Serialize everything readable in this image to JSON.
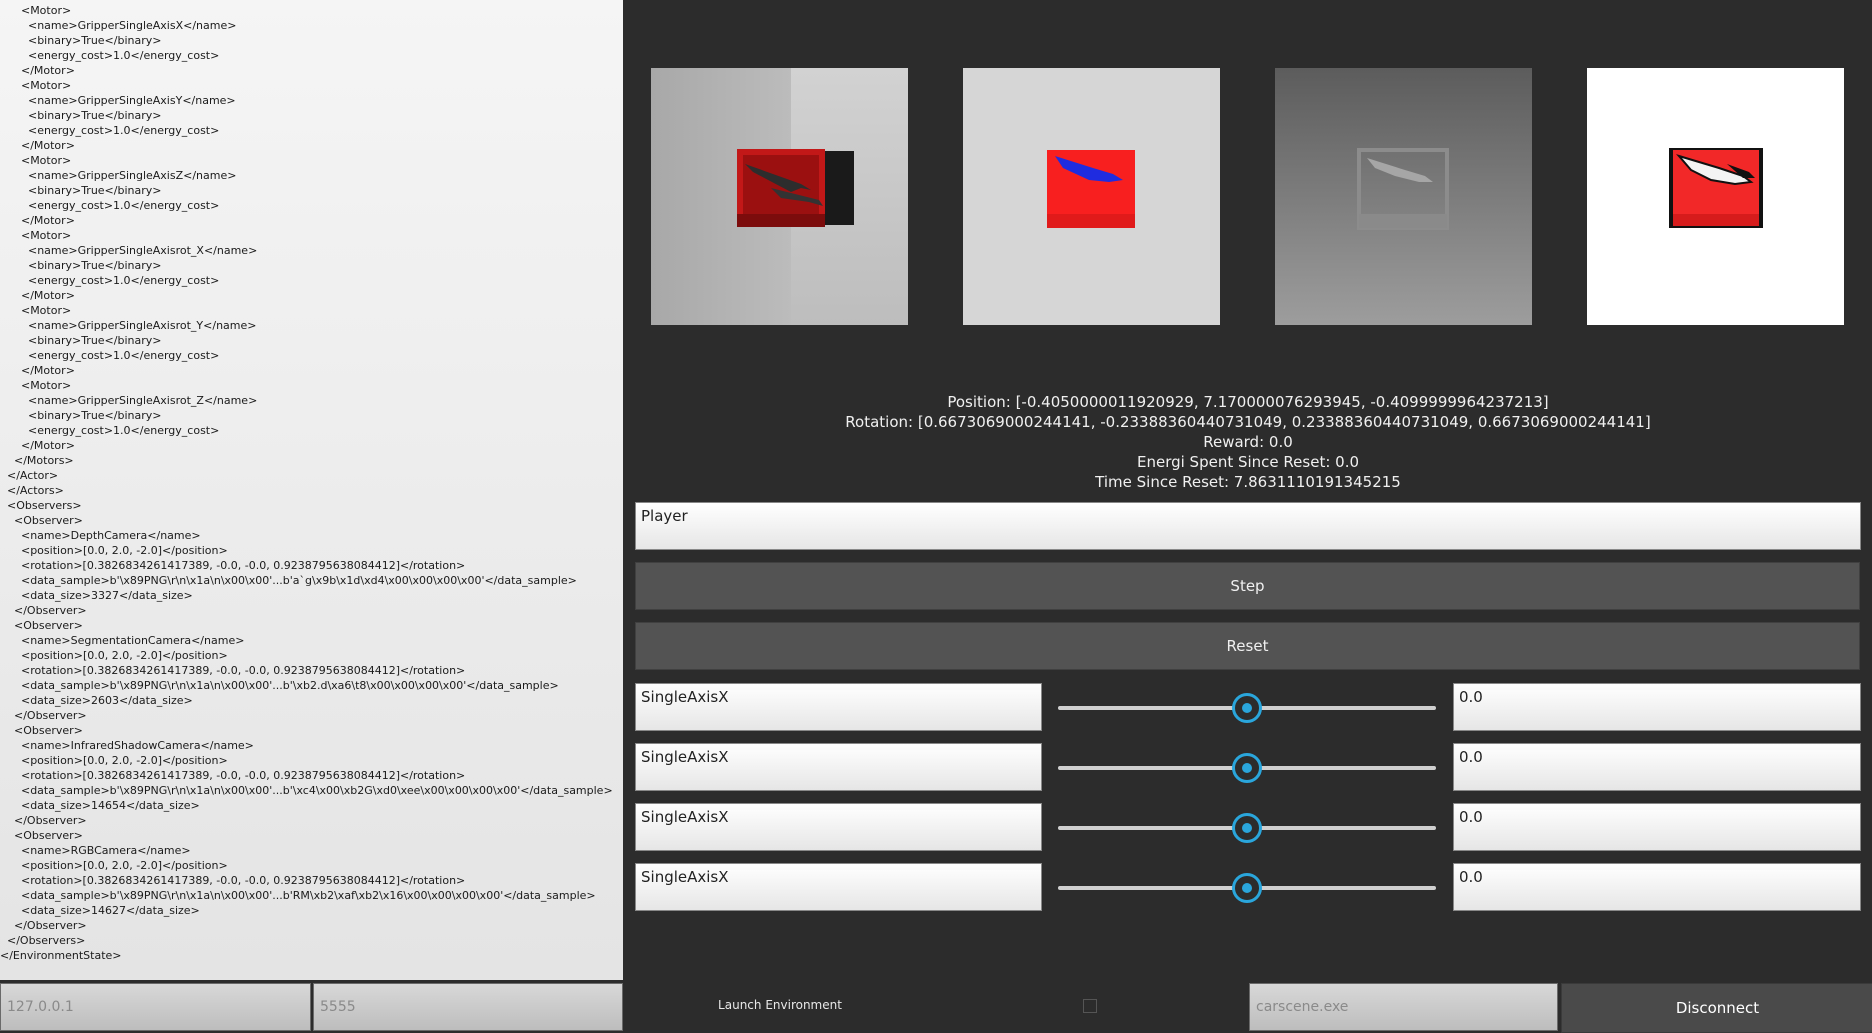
{
  "xml_lines": [
    "      <Motor>",
    "        <name>GripperSingleAxisX</name>",
    "        <binary>True</binary>",
    "        <energy_cost>1.0</energy_cost>",
    "      </Motor>",
    "      <Motor>",
    "        <name>GripperSingleAxisY</name>",
    "        <binary>True</binary>",
    "        <energy_cost>1.0</energy_cost>",
    "      </Motor>",
    "      <Motor>",
    "        <name>GripperSingleAxisZ</name>",
    "        <binary>True</binary>",
    "        <energy_cost>1.0</energy_cost>",
    "      </Motor>",
    "      <Motor>",
    "        <name>GripperSingleAxisrot_X</name>",
    "        <binary>True</binary>",
    "        <energy_cost>1.0</energy_cost>",
    "      </Motor>",
    "      <Motor>",
    "        <name>GripperSingleAxisrot_Y</name>",
    "        <binary>True</binary>",
    "        <energy_cost>1.0</energy_cost>",
    "      </Motor>",
    "      <Motor>",
    "        <name>GripperSingleAxisrot_Z</name>",
    "        <binary>True</binary>",
    "        <energy_cost>1.0</energy_cost>",
    "      </Motor>",
    "    </Motors>",
    "  </Actor>",
    "  </Actors>",
    "  <Observers>",
    "    <Observer>",
    "      <name>DepthCamera</name>",
    "      <position>[0.0, 2.0, -2.0]</position>",
    "      <rotation>[0.3826834261417389, -0.0, -0.0, 0.9238795638084412]</rotation>",
    "      <data_sample>b'\\x89PNG\\r\\n\\x1a\\n\\x00\\x00'...b'a`g\\x9b\\x1d\\xd4\\x00\\x00\\x00\\x00'</data_sample>",
    "      <data_size>3327</data_size>",
    "    </Observer>",
    "    <Observer>",
    "      <name>SegmentationCamera</name>",
    "      <position>[0.0, 2.0, -2.0]</position>",
    "      <rotation>[0.3826834261417389, -0.0, -0.0, 0.9238795638084412]</rotation>",
    "      <data_sample>b'\\x89PNG\\r\\n\\x1a\\n\\x00\\x00'...b'\\xb2.d\\xa6\\t8\\x00\\x00\\x00\\x00'</data_sample>",
    "      <data_size>2603</data_size>",
    "    </Observer>",
    "    <Observer>",
    "      <name>InfraredShadowCamera</name>",
    "      <position>[0.0, 2.0, -2.0]</position>",
    "      <rotation>[0.3826834261417389, -0.0, -0.0, 0.9238795638084412]</rotation>",
    "      <data_sample>b'\\x89PNG\\r\\n\\x1a\\n\\x00\\x00'...b'\\xc4\\x00\\xb2G\\xd0\\xee\\x00\\x00\\x00\\x00'</data_sample>",
    "      <data_size>14654</data_size>",
    "    </Observer>",
    "    <Observer>",
    "      <name>RGBCamera</name>",
    "      <position>[0.0, 2.0, -2.0]</position>",
    "      <rotation>[0.3826834261417389, -0.0, -0.0, 0.9238795638084412]</rotation>",
    "      <data_sample>b'\\x89PNG\\r\\n\\x1a\\n\\x00\\x00'...b'RM\\xb2\\xaf\\xb2\\x16\\x00\\x00\\x00\\x00'</data_sample>",
    "      <data_size>14627</data_size>",
    "    </Observer>",
    "  </Observers>",
    "</EnvironmentState>"
  ],
  "connection": {
    "ip": "127.0.0.1",
    "port": "5555",
    "launch_label": "Launch Environment",
    "launch_checked": false,
    "executable": "carscene.exe",
    "disconnect_label": "Disconnect"
  },
  "cameras": [
    {
      "name": "depth-camera-view"
    },
    {
      "name": "segmentation-camera-view"
    },
    {
      "name": "infrared-shadow-camera-view"
    },
    {
      "name": "rgb-camera-view"
    }
  ],
  "status": {
    "position": "Position: [-0.4050000011920929, 7.170000076293945, -0.4099999964237213]",
    "rotation": "Rotation: [0.6673069000244141, -0.23388360440731049, 0.23388360440731049, 0.6673069000244141]",
    "reward": "Reward: 0.0",
    "energy": "Energi Spent Since Reset: 0.0",
    "time": "Time Since Reset: 7.8631110191345215"
  },
  "player_field": "Player",
  "step_label": "Step",
  "reset_label": "Reset",
  "motors": [
    {
      "label": "SingleAxisX",
      "value": "0.0",
      "slider_fraction": 0.5
    },
    {
      "label": "SingleAxisX",
      "value": "0.0",
      "slider_fraction": 0.5
    },
    {
      "label": "SingleAxisX",
      "value": "0.0",
      "slider_fraction": 0.5
    },
    {
      "label": "SingleAxisX",
      "value": "0.0",
      "slider_fraction": 0.5
    }
  ],
  "colors": {
    "accent": "#2aa6dc",
    "background": "#2c2c2c",
    "box_red": "#e22020",
    "segmentation_blue": "#1f2ce0"
  }
}
